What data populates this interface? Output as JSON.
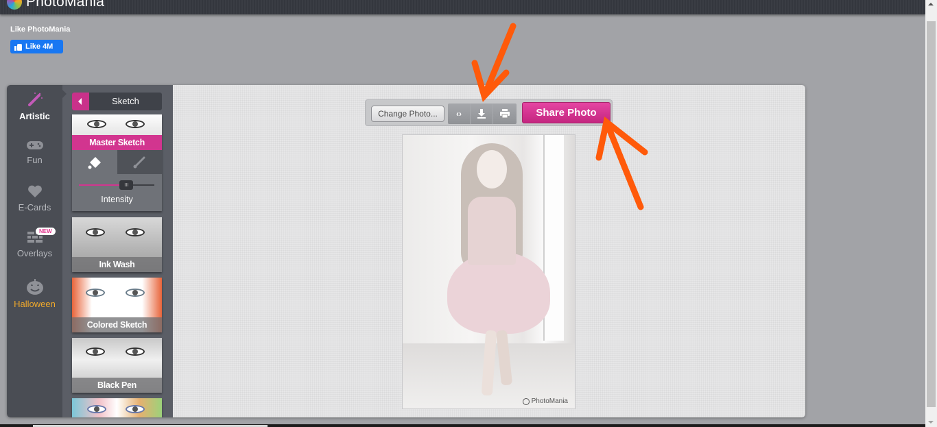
{
  "header": {
    "app_name": "PhotoMania",
    "logo_icon": "photomania-logo-icon"
  },
  "social": {
    "like_label": "Like PhotoMania",
    "like_button": "Like 4M",
    "like_icon": "thumbs-up-icon",
    "brand_color": "#1877f2"
  },
  "categories": [
    {
      "label": "Artistic",
      "icon": "magic-wand-icon",
      "active": true
    },
    {
      "label": "Fun",
      "icon": "gamepad-icon",
      "active": false
    },
    {
      "label": "E-Cards",
      "icon": "heart-icon",
      "active": false
    },
    {
      "label": "Overlays",
      "icon": "brick-wall-icon",
      "active": false,
      "badge": "NEW"
    },
    {
      "label": "Halloween",
      "icon": "pumpkin-icon",
      "active": false,
      "highlight_color": "#f0a92b"
    }
  ],
  "filter_panel": {
    "title": "Sketch",
    "back_icon": "caret-left-icon",
    "selected": {
      "name": "Master Sketch",
      "tools": [
        "paint-bucket-icon",
        "brush-icon"
      ],
      "slider_label": "Intensity",
      "intensity_percent": 63
    },
    "filters": [
      {
        "name": "Ink Wash"
      },
      {
        "name": "Colored Sketch"
      },
      {
        "name": "Black Pen"
      },
      {
        "name": ""
      }
    ]
  },
  "toolbar": {
    "change_photo": "Change Photo...",
    "compare_icon": "compare-arrows-icon",
    "compare_glyph": "‹›",
    "download_icon": "download-icon",
    "print_icon": "print-icon",
    "share_photo": "Share Photo",
    "accent_color": "#d2358f"
  },
  "photo": {
    "watermark": "PhotoMania",
    "description": "Sketch-effect photo of a smiling girl in a pink ruffled dress"
  },
  "annotations": {
    "color": "#ff5a0a",
    "arrows": [
      "arrow-pointing-to-download",
      "arrow-pointing-to-share-photo"
    ]
  }
}
